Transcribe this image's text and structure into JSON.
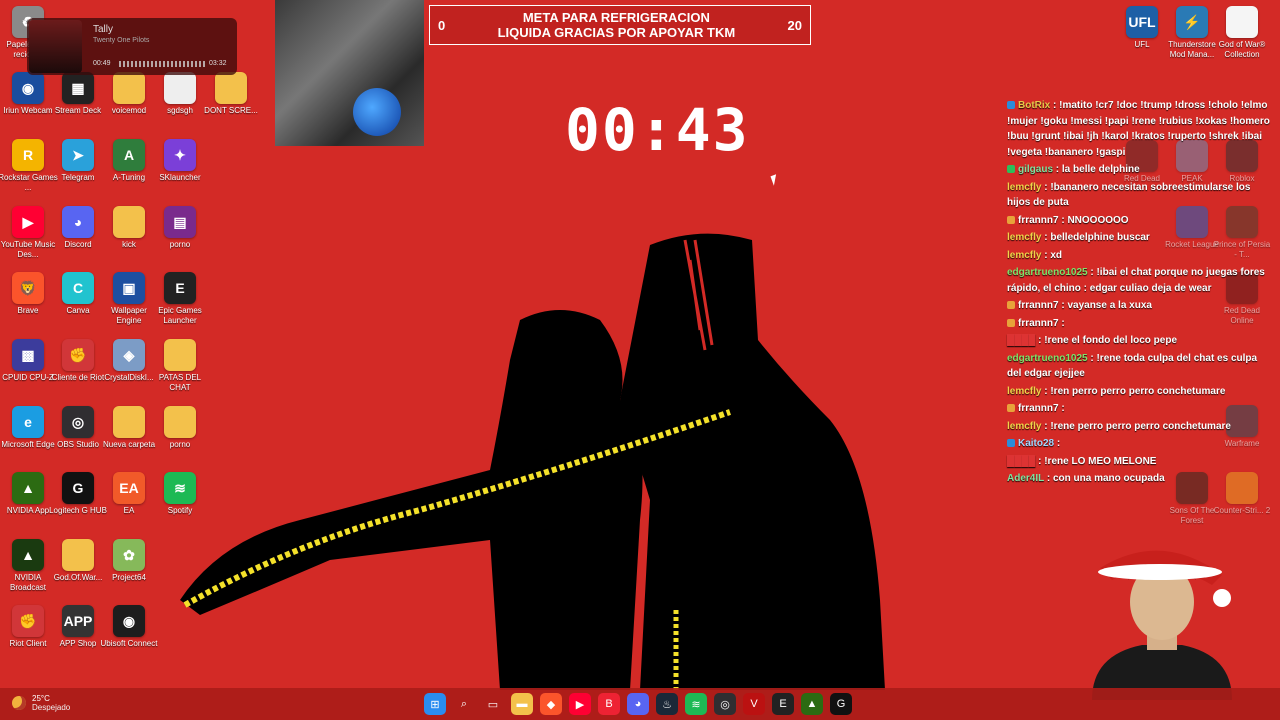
{
  "stream": {
    "meta_title": "META PARA REFRIGERACION\nLIQUIDA GRACIAS POR APOYAR TKM",
    "meta_start": "0",
    "meta_end": "20",
    "timer": "00:43"
  },
  "music": {
    "song": "Tally",
    "artist": "Twenty One Pilots",
    "elapsed": "00:49",
    "total": "03:32",
    "progress_fraction": 0.23
  },
  "desktop_icons": [
    {
      "label": "Papelera de reciclaje",
      "icon": "recycle-bin-icon",
      "color": "#8a8a8a",
      "glyph": "♻"
    },
    {
      "label": "Iriun Webcam",
      "icon": "webcam-icon",
      "color": "#1a4d9e",
      "glyph": "◉"
    },
    {
      "label": "Stream Deck",
      "icon": "stream-deck-icon",
      "color": "#222",
      "glyph": "▦"
    },
    {
      "label": "voicemod",
      "icon": "folder-icon",
      "color": "#f3c14b",
      "glyph": ""
    },
    {
      "label": "sgdsgh",
      "icon": "image-file-icon",
      "color": "#eee",
      "glyph": ""
    },
    {
      "label": "DONT SCRE...",
      "icon": "folder-icon",
      "color": "#f3c14b",
      "glyph": ""
    },
    {
      "label": "Rockstar Games ...",
      "icon": "rockstar-icon",
      "color": "#f4b400",
      "glyph": "R"
    },
    {
      "label": "Telegram",
      "icon": "telegram-icon",
      "color": "#2aa1da",
      "glyph": "➤"
    },
    {
      "label": "A-Tuning",
      "icon": "a-tuning-icon",
      "color": "#2f7d3c",
      "glyph": "A"
    },
    {
      "label": "SKlauncher",
      "icon": "sklauncher-icon",
      "color": "#7b3fd8",
      "glyph": "✦"
    },
    {
      "label": "YouTube Music Des...",
      "icon": "youtube-music-icon",
      "color": "#ff0033",
      "glyph": "▶"
    },
    {
      "label": "Discord",
      "icon": "discord-icon",
      "color": "#5865f2",
      "glyph": "◕"
    },
    {
      "label": "kick",
      "icon": "folder-icon",
      "color": "#f3c14b",
      "glyph": ""
    },
    {
      "label": "porno",
      "icon": "winrar-icon",
      "color": "#7a2a8c",
      "glyph": "▤"
    },
    {
      "label": "Brave",
      "icon": "brave-icon",
      "color": "#fb542b",
      "glyph": "🦁"
    },
    {
      "label": "Canva",
      "icon": "canva-icon",
      "color": "#21c3cf",
      "glyph": "C"
    },
    {
      "label": "Wallpaper Engine",
      "icon": "wallpaper-engine-icon",
      "color": "#1d4fa0",
      "glyph": "▣"
    },
    {
      "label": "Epic Games Launcher",
      "icon": "epic-games-icon",
      "color": "#222",
      "glyph": "E"
    },
    {
      "label": "CPUID CPU-Z",
      "icon": "cpu-z-icon",
      "color": "#3c3c9c",
      "glyph": "▩"
    },
    {
      "label": "Cliente de Riot",
      "icon": "riot-client-icon",
      "color": "#d13639",
      "glyph": "✊"
    },
    {
      "label": "CrystalDiskI...",
      "icon": "crystal-disk-icon",
      "color": "#7c9cc6",
      "glyph": "◈"
    },
    {
      "label": "PATAS DEL CHAT",
      "icon": "folder-icon",
      "color": "#f3c14b",
      "glyph": ""
    },
    {
      "label": "Microsoft Edge",
      "icon": "edge-icon",
      "color": "#1b9de2",
      "glyph": "e"
    },
    {
      "label": "OBS Studio",
      "icon": "obs-icon",
      "color": "#302e31",
      "glyph": "◎"
    },
    {
      "label": "Nueva carpeta",
      "icon": "folder-icon",
      "color": "#f3c14b",
      "glyph": ""
    },
    {
      "label": "porno",
      "icon": "folder-icon",
      "color": "#f3c14b",
      "glyph": ""
    },
    {
      "label": "NVIDIA App",
      "icon": "nvidia-icon",
      "color": "#2c6b12",
      "glyph": "▲"
    },
    {
      "label": "Logitech G HUB",
      "icon": "logitech-icon",
      "color": "#111",
      "glyph": "G"
    },
    {
      "label": "EA",
      "icon": "ea-icon",
      "color": "#f15a29",
      "glyph": "EA"
    },
    {
      "label": "Spotify",
      "icon": "spotify-icon",
      "color": "#1db954",
      "glyph": "≋"
    },
    {
      "label": "NVIDIA Broadcast",
      "icon": "nvidia-broadcast-icon",
      "color": "#1a3a10",
      "glyph": "▲"
    },
    {
      "label": "God.Of.War...",
      "icon": "folder-icon",
      "color": "#f3c14b",
      "glyph": ""
    },
    {
      "label": "Project64",
      "icon": "project64-icon",
      "color": "#86b95a",
      "glyph": "✿"
    },
    {
      "label": "Riot Client",
      "icon": "riot-client-icon",
      "color": "#d13639",
      "glyph": "✊"
    },
    {
      "label": "APP Shop",
      "icon": "app-shop-icon",
      "color": "#333",
      "glyph": "APP"
    },
    {
      "label": "Ubisoft Connect",
      "icon": "ubisoft-icon",
      "color": "#1d1d1d",
      "glyph": "◉"
    },
    {
      "label": "UFL",
      "icon": "ufl-icon",
      "color": "#1d5fa6",
      "glyph": "UFL"
    },
    {
      "label": "Thunderstore Mod Mana...",
      "icon": "thunderstore-icon",
      "color": "#2a7ab5",
      "glyph": "⚡"
    },
    {
      "label": "God of War® Collection",
      "icon": "document-icon",
      "color": "#f5f5f5",
      "glyph": ""
    }
  ],
  "right_icons": [
    {
      "label": "Red Dead",
      "icon": "red-dead-icon",
      "color": "#5a2a2a"
    },
    {
      "label": "PEAK",
      "icon": "peak-icon",
      "color": "#6b8db5"
    },
    {
      "label": "Roblox",
      "icon": "roblox-icon",
      "color": "#333"
    },
    {
      "label": "Rocket League",
      "icon": "rocket-league-icon",
      "color": "#1d63c4"
    },
    {
      "label": "Prince of Persia - T...",
      "icon": "prince-persia-icon",
      "color": "#4a4030"
    },
    {
      "label": "Red Dead Online",
      "icon": "red-dead-online-icon",
      "color": "#5a1a1a"
    },
    {
      "label": "Warframe",
      "icon": "warframe-icon",
      "color": "#2a4d5c"
    },
    {
      "label": "Sons Of The Forest",
      "icon": "sons-forest-icon",
      "color": "#2e2a22"
    },
    {
      "label": "Counter-Stri... 2",
      "icon": "cs2-icon",
      "color": "#e9a125"
    }
  ],
  "chat": [
    {
      "user": "BotRix",
      "color": "#e8c84a",
      "badge": "#2b8cd9",
      "text": "!matito !cr7 !doc !trump !dross !cholo !elmo !mujer !goku !messi !papi !rene !rubius !xokas !homero !buu !grunt !ibai !jh !karol !kratos !ruperto !shrek !ibai !vegeta !bananero !gaspi"
    },
    {
      "user": "gilgaus",
      "color": "#7fe3a0",
      "badge": "#2bbf5a",
      "text": "la belle delphine"
    },
    {
      "user": "lemcfly",
      "color": "#f3d24a",
      "badge": "",
      "text": "!bananero necesitan sobreestimularse los hijos de puta"
    },
    {
      "user": "frrannn7",
      "color": "#fff",
      "badge": "#e8a23a",
      "text": "NNOOOOOO"
    },
    {
      "user": "lemcfly",
      "color": "#f3d24a",
      "badge": "",
      "text": "belledelphine buscar"
    },
    {
      "user": "lemcfly",
      "color": "#f3d24a",
      "badge": "",
      "text": "xd"
    },
    {
      "user": "edgartrueno1025",
      "color": "#7fe36a",
      "badge": "",
      "text": "!ibai el chat porque no juegas fores rápido, el chino : edgar culiao deja de wear"
    },
    {
      "user": "frrannn7",
      "color": "#fff",
      "badge": "#e8a23a",
      "text": "vayanse a la xuxa"
    },
    {
      "user": "frrannn7",
      "color": "#fff",
      "badge": "#e8a23a",
      "text": ""
    },
    {
      "user": "",
      "color": "#d33",
      "badge": "",
      "text": "!rene el fondo del loco pepe"
    },
    {
      "user": "edgartrueno1025",
      "color": "#7fe36a",
      "badge": "",
      "text": "!rene toda culpa del chat es culpa del edgar ejejjee"
    },
    {
      "user": "lemcfly",
      "color": "#f3d24a",
      "badge": "",
      "text": "!ren perro perro perro conchetumare"
    },
    {
      "user": "frrannn7",
      "color": "#fff",
      "badge": "#e8a23a",
      "text": ""
    },
    {
      "user": "lemcfly",
      "color": "#f3d24a",
      "badge": "",
      "text": "!rene perro perro perro conchetumare"
    },
    {
      "user": "Kaito28",
      "color": "#a0d8ff",
      "badge": "#2b8cd9",
      "text": ""
    },
    {
      "user": "",
      "color": "#d33",
      "badge": "",
      "text": "!rene LO MEO MELONE"
    },
    {
      "user": "Ader4IL",
      "color": "#7fe3a0",
      "badge": "",
      "text": "con una mano ocupada"
    }
  ],
  "taskbar": {
    "temperature": "25°C",
    "condition": "Despejado",
    "icons": [
      {
        "name": "start-icon",
        "color": "#2a8cf0",
        "glyph": "⊞"
      },
      {
        "name": "search-icon",
        "color": "transparent",
        "glyph": "⌕"
      },
      {
        "name": "task-view-icon",
        "color": "transparent",
        "glyph": "▭"
      },
      {
        "name": "file-explorer-icon",
        "color": "#f3c14b",
        "glyph": "▬"
      },
      {
        "name": "brave-icon",
        "color": "#fb542b",
        "glyph": "◆"
      },
      {
        "name": "youtube-music-icon",
        "color": "#ff0033",
        "glyph": "▶"
      },
      {
        "name": "app-icon",
        "color": "#e23",
        "glyph": "B"
      },
      {
        "name": "discord-icon",
        "color": "#5865f2",
        "glyph": "◕"
      },
      {
        "name": "steam-icon",
        "color": "#1b2838",
        "glyph": "♨"
      },
      {
        "name": "spotify-icon",
        "color": "#1db954",
        "glyph": "≋"
      },
      {
        "name": "obs-icon",
        "color": "#302e31",
        "glyph": "◎"
      },
      {
        "name": "valorant-icon",
        "color": "#b11",
        "glyph": "V"
      },
      {
        "name": "epic-games-icon",
        "color": "#222",
        "glyph": "E"
      },
      {
        "name": "nvidia-icon",
        "color": "#2c6b12",
        "glyph": "▲"
      },
      {
        "name": "logitech-icon",
        "color": "#111",
        "glyph": "G"
      }
    ]
  }
}
